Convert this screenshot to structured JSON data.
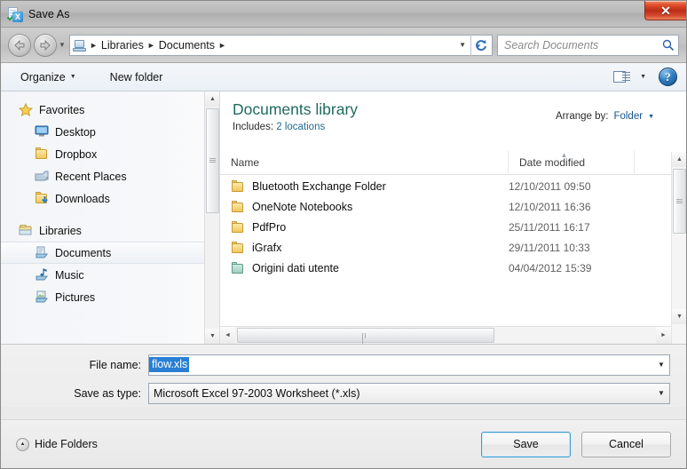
{
  "window": {
    "title": "Save As",
    "title_icon": "excel-save-icon",
    "close_label": "✕"
  },
  "address_bar": {
    "back_icon": "back-arrow-icon",
    "forward_icon": "forward-arrow-icon",
    "history_caret": "▼",
    "path_icon": "library-icon",
    "crumbs": [
      "Libraries",
      "Documents"
    ],
    "separator": "►",
    "dropdown_caret": "▼",
    "refresh_icon": "refresh-icon",
    "search": {
      "placeholder": "Search Documents",
      "icon": "search-icon"
    }
  },
  "toolbar": {
    "organize_label": "Organize",
    "organize_caret": "▼",
    "new_folder_label": "New folder",
    "view_icon": "list-view-icon",
    "view_caret": "▼",
    "help_label": "?",
    "help_icon": "help-icon"
  },
  "sidebar": {
    "groups": [
      {
        "label": "Favorites",
        "icon": "star-icon",
        "items": [
          {
            "label": "Desktop",
            "icon": "desktop-icon"
          },
          {
            "label": "Dropbox",
            "icon": "folder-icon"
          },
          {
            "label": "Recent Places",
            "icon": "recent-places-icon"
          },
          {
            "label": "Downloads",
            "icon": "downloads-icon"
          }
        ]
      },
      {
        "label": "Libraries",
        "icon": "libraries-icon",
        "items": [
          {
            "label": "Documents",
            "icon": "documents-library-icon",
            "selected": true
          },
          {
            "label": "Music",
            "icon": "music-library-icon"
          },
          {
            "label": "Pictures",
            "icon": "pictures-library-icon"
          }
        ]
      }
    ]
  },
  "library": {
    "title": "Documents library",
    "includes_label": "Includes:",
    "includes_link": "2 locations",
    "arrange_label": "Arrange by:",
    "arrange_value": "Folder",
    "arrange_caret": "▼"
  },
  "columns": {
    "name": "Name",
    "date_modified": "Date modified",
    "sort_indicator": "▲"
  },
  "files": [
    {
      "name": "Bluetooth Exchange Folder",
      "date": "12/10/2011 09:50",
      "icon": "folder-icon"
    },
    {
      "name": "OneNote Notebooks",
      "date": "12/10/2011 16:36",
      "icon": "folder-icon"
    },
    {
      "name": "PdfPro",
      "date": "25/11/2011 16:17",
      "icon": "folder-icon"
    },
    {
      "name": "iGrafx",
      "date": "29/11/2011 10:33",
      "icon": "folder-icon"
    },
    {
      "name": "Origini dati utente",
      "date": "04/04/2012 15:39",
      "icon": "system-folder-icon"
    }
  ],
  "form": {
    "file_name_label": "File name:",
    "file_name_value": "flow.xls",
    "save_as_type_label": "Save as type:",
    "save_as_type_value": "Microsoft Excel 97-2003 Worksheet (*.xls)",
    "dropdown_caret": "▼"
  },
  "footer": {
    "hide_folders_label": "Hide Folders",
    "hide_folders_icon": "chevron-up-circle-icon",
    "save_label": "Save",
    "cancel_label": "Cancel"
  },
  "scrollbars": {
    "up_arrow": "▲",
    "down_arrow": "▼",
    "left_arrow": "◄",
    "right_arrow": "►"
  },
  "colors": {
    "library_title": "#1f6b5e",
    "link": "#1f6b8e",
    "selection": "#2a7fd4",
    "close_button": "#bb2c16",
    "default_button_border": "#3c9bd4"
  }
}
